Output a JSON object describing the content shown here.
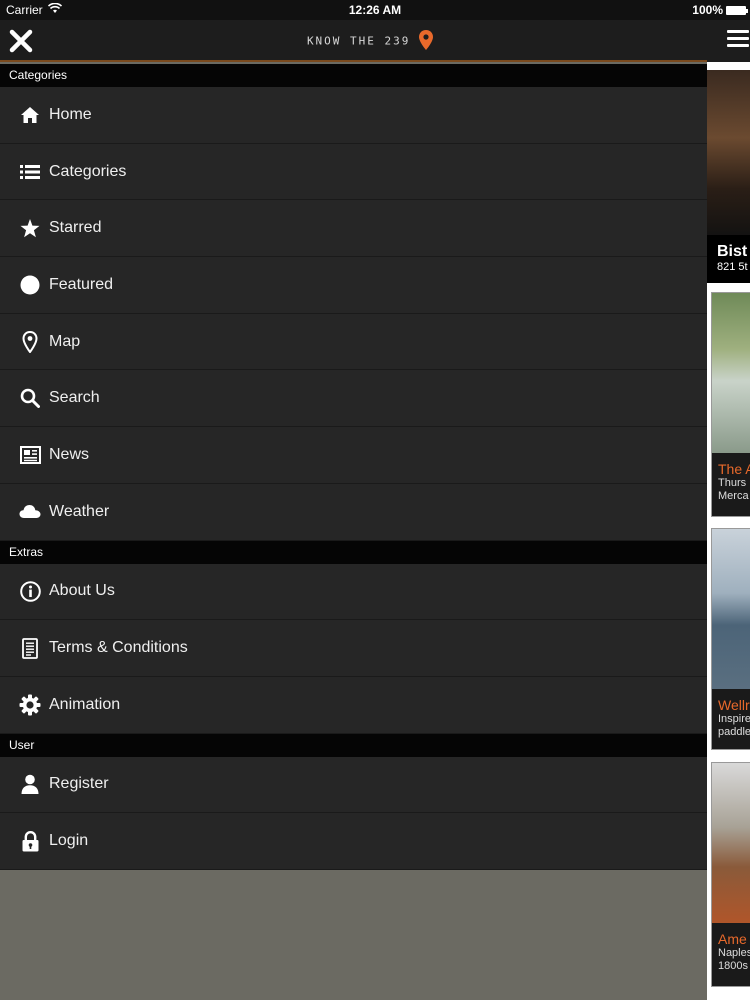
{
  "status_bar": {
    "carrier": "Carrier",
    "time": "12:26 AM",
    "battery": "100%"
  },
  "header": {
    "logo_text": "KNOW THE 239"
  },
  "menu": {
    "sections": [
      {
        "title": "Categories",
        "items": [
          {
            "label": "Home",
            "icon": "home-icon"
          },
          {
            "label": "Categories",
            "icon": "list-icon"
          },
          {
            "label": "Starred",
            "icon": "star-icon"
          },
          {
            "label": "Featured",
            "icon": "circle-icon"
          },
          {
            "label": "Map",
            "icon": "map-pin-icon"
          },
          {
            "label": "Search",
            "icon": "search-icon"
          },
          {
            "label": "News",
            "icon": "newspaper-icon"
          },
          {
            "label": "Weather",
            "icon": "cloud-icon"
          }
        ]
      },
      {
        "title": "Extras",
        "items": [
          {
            "label": "About Us",
            "icon": "info-icon"
          },
          {
            "label": "Terms & Conditions",
            "icon": "document-icon"
          },
          {
            "label": "Animation",
            "icon": "gear-icon"
          }
        ]
      },
      {
        "title": "User",
        "items": [
          {
            "label": "Register",
            "icon": "user-icon"
          },
          {
            "label": "Login",
            "icon": "lock-icon"
          }
        ]
      }
    ]
  },
  "background_content": {
    "hero": {
      "title": "Bist",
      "subtitle": "821 5t"
    },
    "cards": [
      {
        "title": "The A",
        "line1": "Thurs",
        "line2": "Merca"
      },
      {
        "title": "Wellr",
        "line1": "Inspire",
        "line2": "paddle"
      },
      {
        "title": "Ame",
        "line1": "Naples",
        "line2": "1800s"
      }
    ]
  },
  "colors": {
    "accent": "#e8692b",
    "menu_bg": "#262626",
    "section_bg": "#050505"
  }
}
